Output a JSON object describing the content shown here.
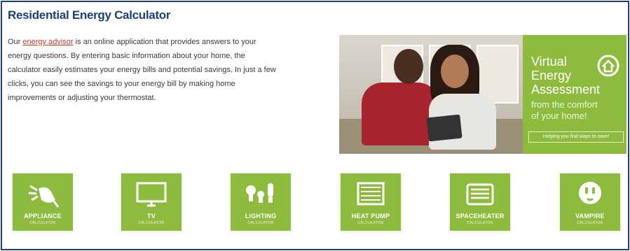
{
  "page": {
    "title": "Residential Energy Calculator",
    "intro_prefix": "Our ",
    "intro_link": "energy advisor",
    "intro_rest_1": " is an online application that provides answers to your",
    "intro_line2": "energy questions. By entering basic information about your home, the",
    "intro_line3": "calculator easily estimates your energy bills and potential savings. In just a few",
    "intro_line4": "clicks, you can see the savings to your energy bill by making home",
    "intro_line5": "improvements or adjusting your thermostat."
  },
  "promo": {
    "line1": "Virtual",
    "line2": "Energy",
    "line3": "Assessment",
    "sub1": "from the comfort",
    "sub2": "of your home!",
    "button": "Helping you find ways to save!",
    "panel_color": "#8dbb3e"
  },
  "tiles": [
    {
      "name": "APPLIANCE",
      "sub": "CALCULATOR",
      "icon": "plug-icon"
    },
    {
      "name": "TV",
      "sub": "CALCULATOR",
      "icon": "tv-icon"
    },
    {
      "name": "LIGHTING",
      "sub": "CALCULATOR",
      "icon": "lightbulb-icon"
    },
    {
      "name": "HEAT PUMP",
      "sub": "CALCULATOR",
      "icon": "heat-pump-icon"
    },
    {
      "name": "SPACEHEATER",
      "sub": "CALCULATOR",
      "icon": "space-heater-icon"
    },
    {
      "name": "VAMPIRE",
      "sub": "CALCULATOR",
      "icon": "outlet-icon"
    }
  ],
  "colors": {
    "title": "#1f3f7a",
    "link": "#c0392b",
    "tile_green": "#8dbb3e"
  }
}
